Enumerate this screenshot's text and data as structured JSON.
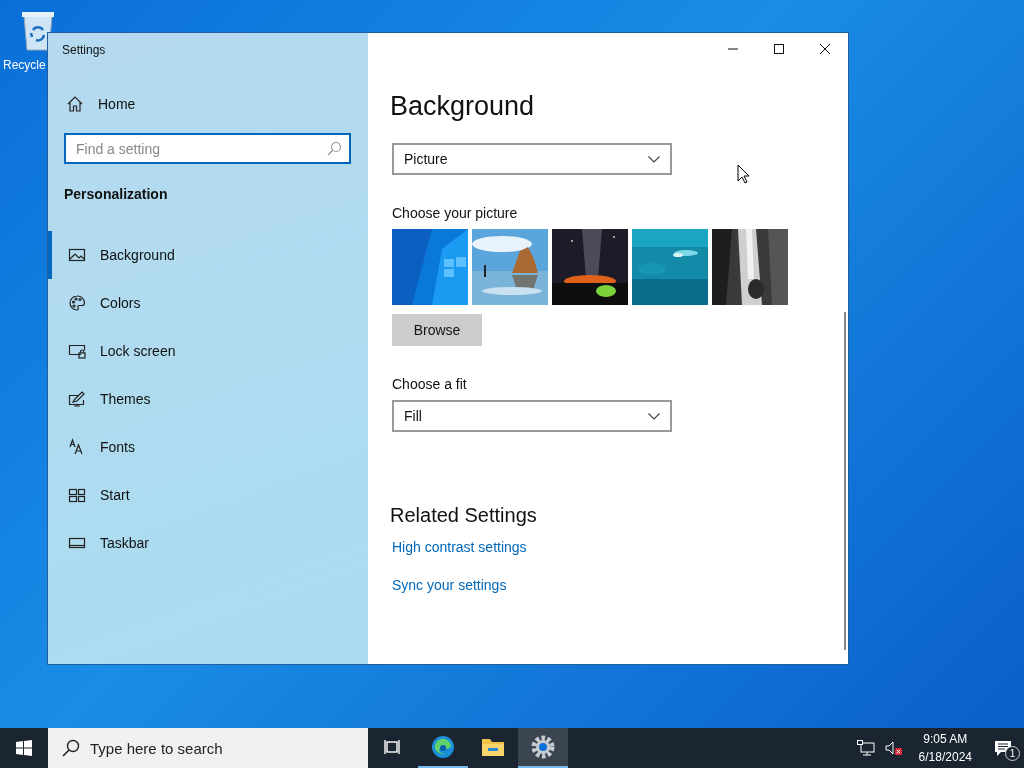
{
  "desktop": {
    "icons": [
      {
        "label": "Recycle"
      }
    ]
  },
  "window": {
    "title": "Settings"
  },
  "sidebar": {
    "home": "Home",
    "search": {
      "placeholder": "Find a setting"
    },
    "section": "Personalization",
    "items": [
      {
        "label": "Background",
        "kind": "background",
        "selected": true
      },
      {
        "label": "Colors",
        "kind": "colors",
        "selected": false
      },
      {
        "label": "Lock screen",
        "kind": "lock",
        "selected": false
      },
      {
        "label": "Themes",
        "kind": "themes",
        "selected": false
      },
      {
        "label": "Fonts",
        "kind": "fonts",
        "selected": false
      },
      {
        "label": "Start",
        "kind": "start",
        "selected": false
      },
      {
        "label": "Taskbar",
        "kind": "taskbar",
        "selected": false
      }
    ]
  },
  "content": {
    "title": "Background",
    "background_value": "Picture",
    "pictures_label": "Choose your picture",
    "browse": "Browse",
    "fit_label": "Choose a fit",
    "fit_value": "Fill",
    "related_title": "Related Settings",
    "links": [
      "High contrast settings",
      "Sync your settings"
    ]
  },
  "taskbar": {
    "search": {
      "placeholder": "Type here to search"
    },
    "apps": [
      {
        "kind": "taskview",
        "running": false,
        "selected": false
      },
      {
        "kind": "edge",
        "running": true,
        "selected": false
      },
      {
        "kind": "explorer",
        "running": false,
        "selected": false
      },
      {
        "kind": "settings",
        "running": true,
        "selected": true
      }
    ],
    "time": "9:05 AM",
    "date": "6/18/2024",
    "notifications": "1"
  }
}
